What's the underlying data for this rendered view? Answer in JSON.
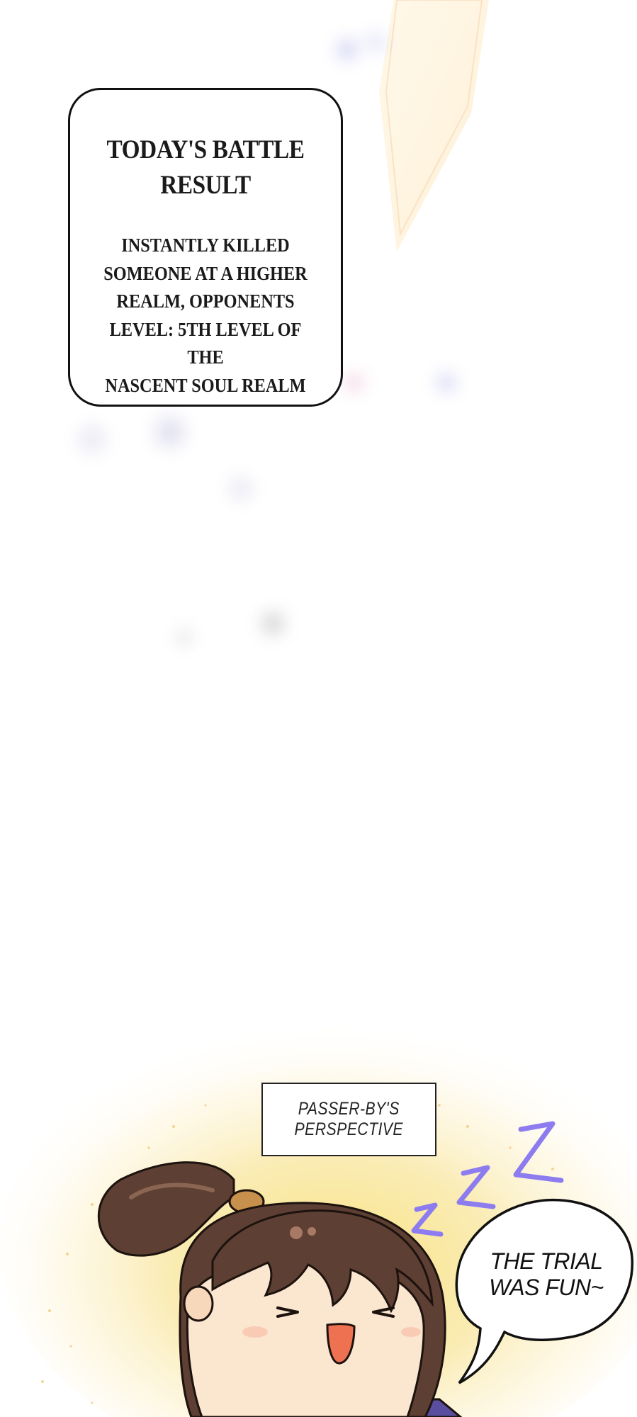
{
  "battle_result": {
    "title_line1": "TODAY'S BATTLE",
    "title_line2": "RESULT",
    "body_lines": [
      "INSTANTLY KILLED",
      "SOMEONE AT A HIGHER",
      "REALM, OPPONENTS",
      "LEVEL: 5TH LEVEL OF THE",
      "NASCENT SOUL REALM"
    ]
  },
  "caption": {
    "line1": "PASSER-BY'S",
    "line2": "PERSPECTIVE"
  },
  "speech": {
    "line1": "THE TRIAL",
    "line2": "WAS FUN~"
  },
  "icons": [
    "sleeping-zzz-icon",
    "chibi-character-illustration",
    "light-streak-decoration"
  ],
  "colors": {
    "glow_yellow": "#f7dc6a",
    "zzz_purple": "#8c7cf0",
    "hair_brown": "#5e3f33",
    "skin": "#fbe6cf",
    "mouth_orange": "#ee7152"
  }
}
